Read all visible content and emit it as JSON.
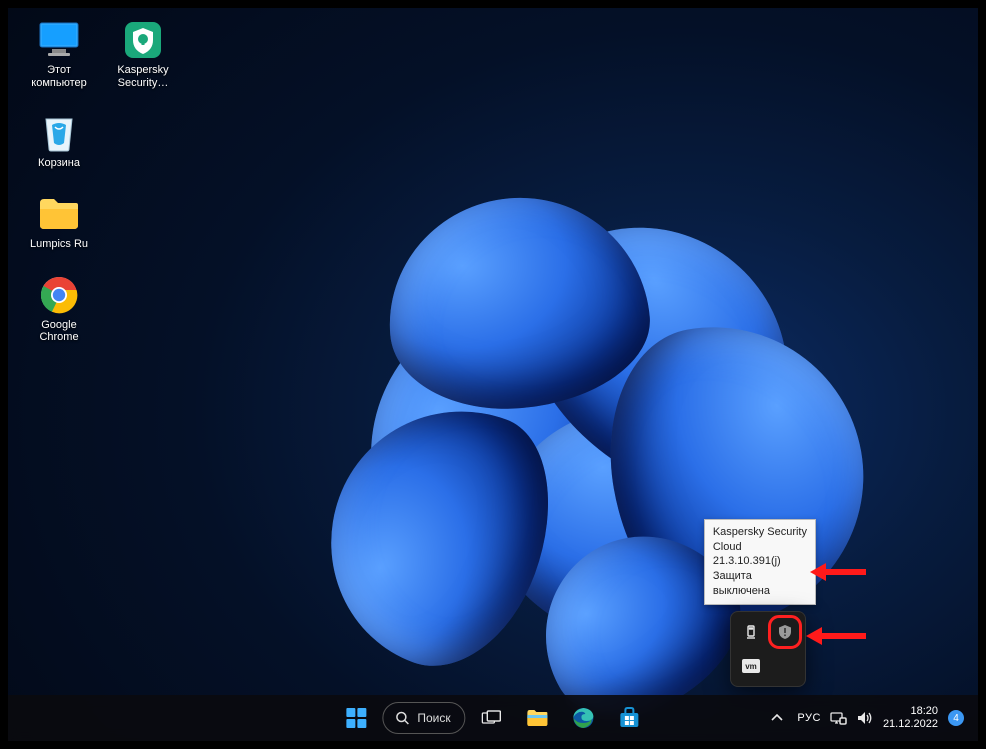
{
  "desktop": {
    "this_pc": "Этот\nкомпьютер",
    "kaspersky": "Kaspersky\nSecurity…",
    "recycle": "Корзина",
    "folder": "Lumpics Ru",
    "chrome": "Google\nChrome"
  },
  "taskbar": {
    "search_label": "Поиск",
    "language": "РУС",
    "time": "18:20",
    "date": "21.12.2022",
    "notif_count": "4"
  },
  "tooltip": {
    "text": "Kaspersky Security\nCloud\n21.3.10.391(j)\nЗащита\nвыключена"
  }
}
